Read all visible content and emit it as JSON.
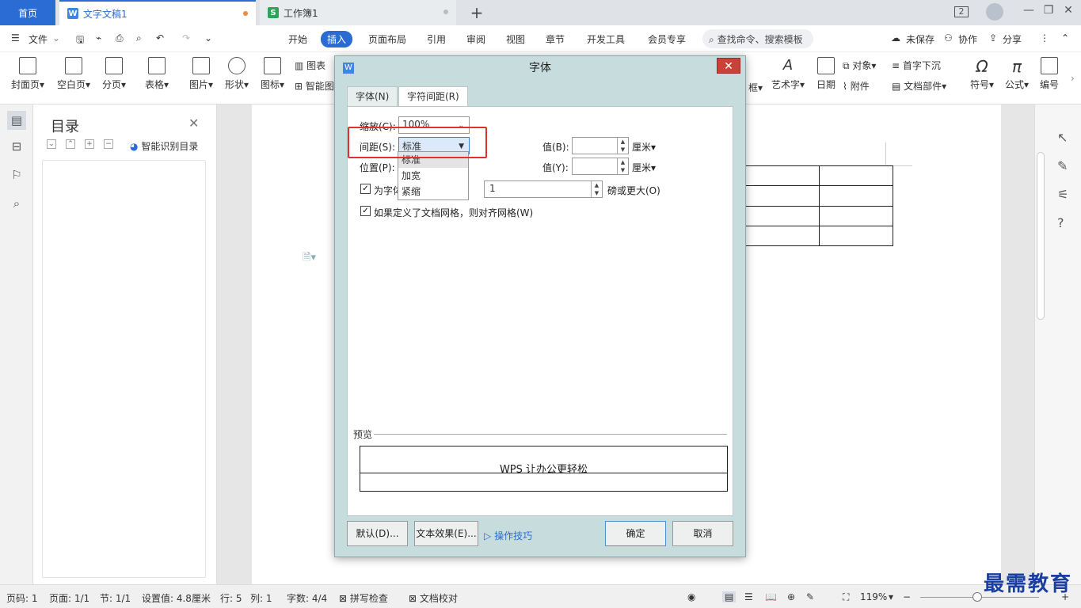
{
  "tabs": {
    "home": "首页",
    "doc": "文字文稿1",
    "sheet": "工作簿1",
    "doc_icon": "W",
    "sheet_icon": "S",
    "window_count": "2"
  },
  "menu": {
    "file": "文件",
    "items": [
      "开始",
      "插入",
      "页面布局",
      "引用",
      "审阅",
      "视图",
      "章节",
      "开发工具",
      "会员专享"
    ],
    "search": "查找命令、搜索模板",
    "unsaved": "未保存",
    "collab": "协作",
    "share": "分享"
  },
  "ribbon": {
    "cover": "封面页",
    "blank": "空白页",
    "pagebreak": "分页",
    "table": "表格",
    "picture": "图片",
    "shape": "形状",
    "iconlib": "图标",
    "chart": "图表",
    "smart": "智能图",
    "textbox_tail": "框",
    "arttext": "艺术字",
    "date": "日期",
    "object": "对象",
    "attachment": "附件",
    "dropcap": "首字下沉",
    "docparts": "文档部件",
    "symbol": "符号",
    "formula": "公式",
    "numbering": "编号"
  },
  "toc": {
    "title": "目录",
    "smart": "智能识别目录"
  },
  "dialog": {
    "title": "字体",
    "app_icon": "W",
    "tab_font": "字体(N)",
    "tab_spacing": "字符间距(R)",
    "scale_label": "缩放(C):",
    "scale_value": "100%",
    "spacing_label": "间距(S):",
    "spacing_value": "标准",
    "position_label": "位置(P):",
    "value_b_label": "值(B):",
    "value_y_label": "值(Y):",
    "unit_b": "厘米",
    "unit_y": "厘米",
    "kerning_label": "为字体",
    "kerning_value": "1",
    "kerning_suffix": "磅或更大(O)",
    "grid_label": "如果定义了文档网格，则对齐网格(W)",
    "dropdown_options": [
      "标准",
      "加宽",
      "紧缩"
    ],
    "preview_label": "预览",
    "preview_text": "WPS 让办公更轻松",
    "btn_default": "默认(D)...",
    "btn_effects": "文本效果(E)...",
    "tips": "操作技巧",
    "btn_ok": "确定",
    "btn_cancel": "取消"
  },
  "status": {
    "page": "页码: 1",
    "pages": "页面: 1/1",
    "section": "节: 1/1",
    "setting": "设置值: 4.8厘米",
    "row": "行: 5",
    "col": "列: 1",
    "words": "字数: 4/4",
    "spell": "拼写检查",
    "proof": "文档校对",
    "zoom": "119%"
  },
  "watermark": "最需教育",
  "colors": {
    "accent": "#2b6cd4",
    "highlight": "#e03030"
  }
}
